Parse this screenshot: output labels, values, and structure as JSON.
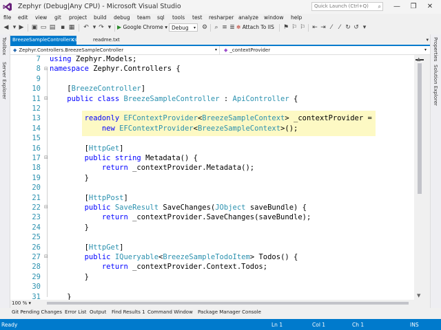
{
  "window": {
    "title": "Zephyr (Debug|Any CPU) - Microsoft Visual Studio",
    "quick_launch_placeholder": "Quick Launch (Ctrl+Q)",
    "controls": {
      "minimize": "—",
      "restore": "❐",
      "close": "✕"
    }
  },
  "menu": [
    "file",
    "edit",
    "view",
    "git",
    "project",
    "build",
    "debug",
    "team",
    "sql",
    "tools",
    "test",
    "resharper",
    "analyze",
    "window",
    "help"
  ],
  "toolbar": {
    "run_target": "Google Chrome",
    "configuration": "Debug",
    "attach_label": "Attach To IIS"
  },
  "side_left": [
    "Toolbox",
    "Server Explorer"
  ],
  "side_right": [
    "Properties",
    "Solution Explorer"
  ],
  "tabs": {
    "active": "BreezeSampleController.cs",
    "other": "readme.txt"
  },
  "navbar": {
    "type": "Zephyr.Controllers.BreezeSampleController",
    "member": "_contextProvider"
  },
  "line_numbers": [
    "7",
    "8",
    "9",
    "10",
    "11",
    "12",
    "13",
    "14",
    "15",
    "16",
    "17",
    "18",
    "19",
    "20",
    "21",
    "22",
    "23",
    "24",
    "25",
    "26",
    "27",
    "28",
    "29",
    "30",
    "31"
  ],
  "code": {
    "l7_kw": "using",
    "l7_rest": " Zephyr.Models;",
    "l8_kw": "namespace",
    "l8_rest": " Zephyr.Controllers {",
    "l10_a": "    [",
    "l10_ty": "BreezeController",
    "l10_b": "]",
    "l11_kw": "    public class ",
    "l11_ty1": "BreezeSampleController",
    "l11_mid": " : ",
    "l11_ty2": "ApiController",
    "l11_end": " {",
    "l13_kw": "        readonly ",
    "l13_ty1": "EFContextProvider",
    "l13_a": "<",
    "l13_ty2": "BreezeSampleContext",
    "l13_b": "> _contextProvider =",
    "l14_kw": "            new ",
    "l14_ty1": "EFContextProvider",
    "l14_a": "<",
    "l14_ty2": "BreezeSampleContext",
    "l14_b": ">();",
    "l16_a": "        [",
    "l16_ty": "HttpGet",
    "l16_b": "]",
    "l17_kw": "        public string ",
    "l17_rest": "Metadata() {",
    "l18_kw": "            return ",
    "l18_rest": "_contextProvider.Metadata();",
    "l19": "        }",
    "l21_a": "        [",
    "l21_ty": "HttpPost",
    "l21_b": "]",
    "l22_kw": "        public ",
    "l22_ty1": "SaveResult",
    "l22_mid": " SaveChanges(",
    "l22_ty2": "JObject",
    "l22_end": " saveBundle) {",
    "l23_kw": "            return ",
    "l23_rest": "_contextProvider.SaveChanges(saveBundle);",
    "l24": "        }",
    "l26_a": "        [",
    "l26_ty": "HttpGet",
    "l26_b": "]",
    "l27_kw": "        public ",
    "l27_ty1": "IQueryable",
    "l27_a": "<",
    "l27_ty2": "BreezeSampleTodoItem",
    "l27_b": "> Todos() {",
    "l28_kw": "            return ",
    "l28_rest": "_contextProvider.Context.Todos;",
    "l29": "        }",
    "l31": "    }"
  },
  "outline_markers": [
    "⊟",
    "⊟",
    "⊟",
    "⊟",
    "⊟"
  ],
  "zoom": "100 %",
  "bottom_tabs": [
    "Git Pending Changes",
    "Error List",
    "Output",
    "Find Results 1",
    "Command Window",
    "Package Manager Console"
  ],
  "status": {
    "state": "Ready",
    "line": "Ln 1",
    "col": "Col 1",
    "ch": "Ch 1",
    "mode": "INS"
  },
  "colors": {
    "accent": "#007acc",
    "highlight": "#fdf9c4",
    "keyword": "#0000ff",
    "type": "#2b91af"
  }
}
